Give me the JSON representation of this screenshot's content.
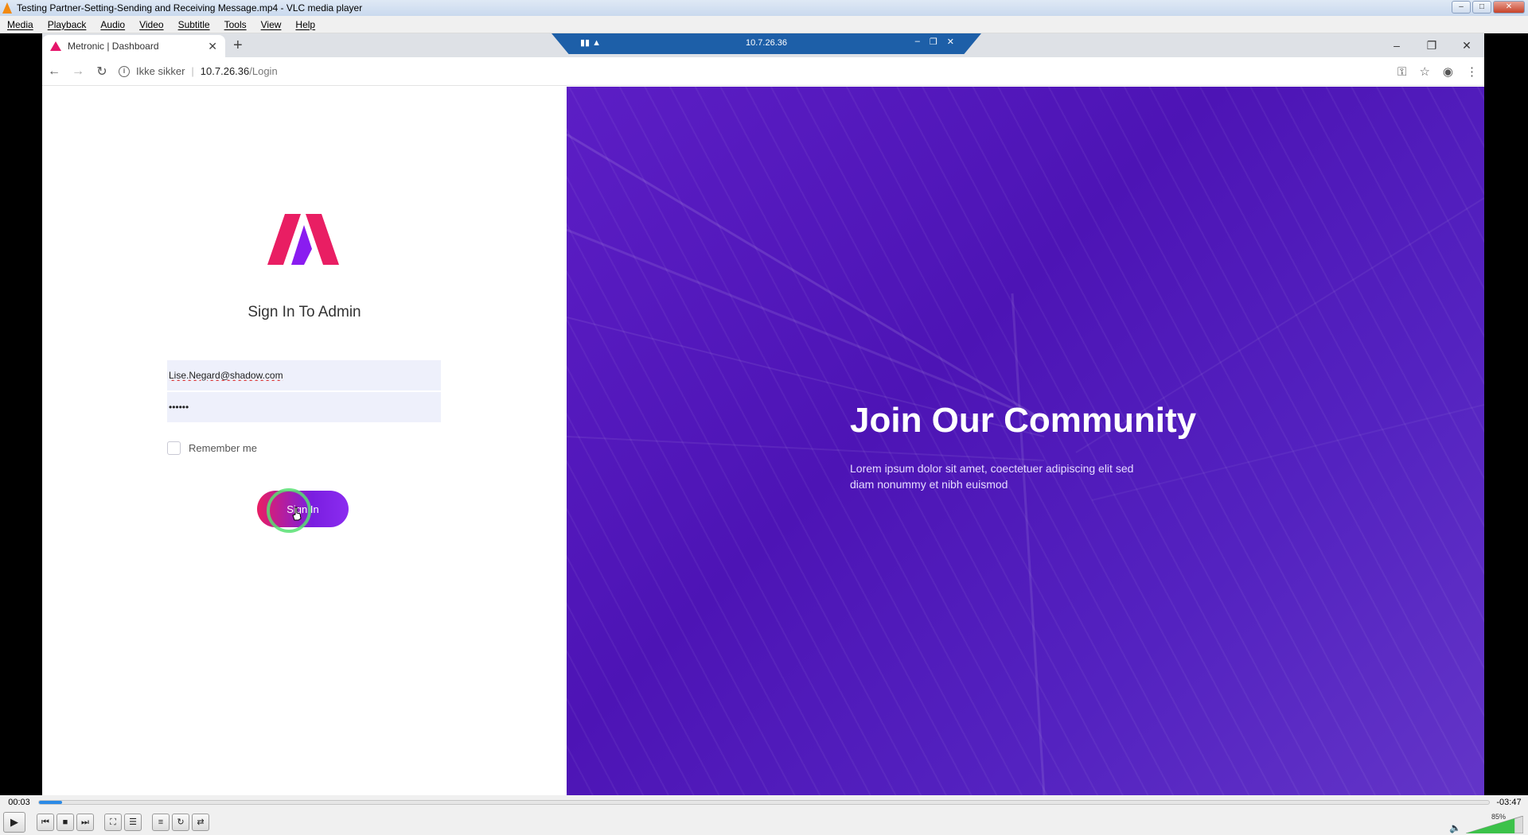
{
  "vlc": {
    "title": "Testing Partner-Setting-Sending and Receiving Message.mp4 - VLC media player",
    "menu": [
      "Media",
      "Playback",
      "Audio",
      "Video",
      "Subtitle",
      "Tools",
      "View",
      "Help"
    ],
    "time_elapsed": "00:03",
    "time_remaining": "-03:47",
    "progress": 0.016,
    "volume_label": "85%",
    "volume": 0.85
  },
  "browser": {
    "tab_title": "Metronic | Dashboard",
    "rdp_host": "10.7.26.36",
    "security_label": "Ikke sikker",
    "url_host": "10.7.26.36",
    "url_path": "/Login"
  },
  "login": {
    "title": "Sign In To Admin",
    "email_value": "Lise.Negard@shadow.com",
    "password_value": "••••••",
    "remember_label": "Remember me",
    "signin_label": "Sign In"
  },
  "hero": {
    "title": "Join Our Community",
    "text": "Lorem ipsum dolor sit amet, coectetuer adipiscing elit sed diam nonummy et nibh euismod"
  },
  "colors": {
    "accent_pink": "#e91e63",
    "accent_purple": "#7a1ee0",
    "hero_bg": "#5c1ec5",
    "vlc_progress": "#2b8ae6"
  }
}
